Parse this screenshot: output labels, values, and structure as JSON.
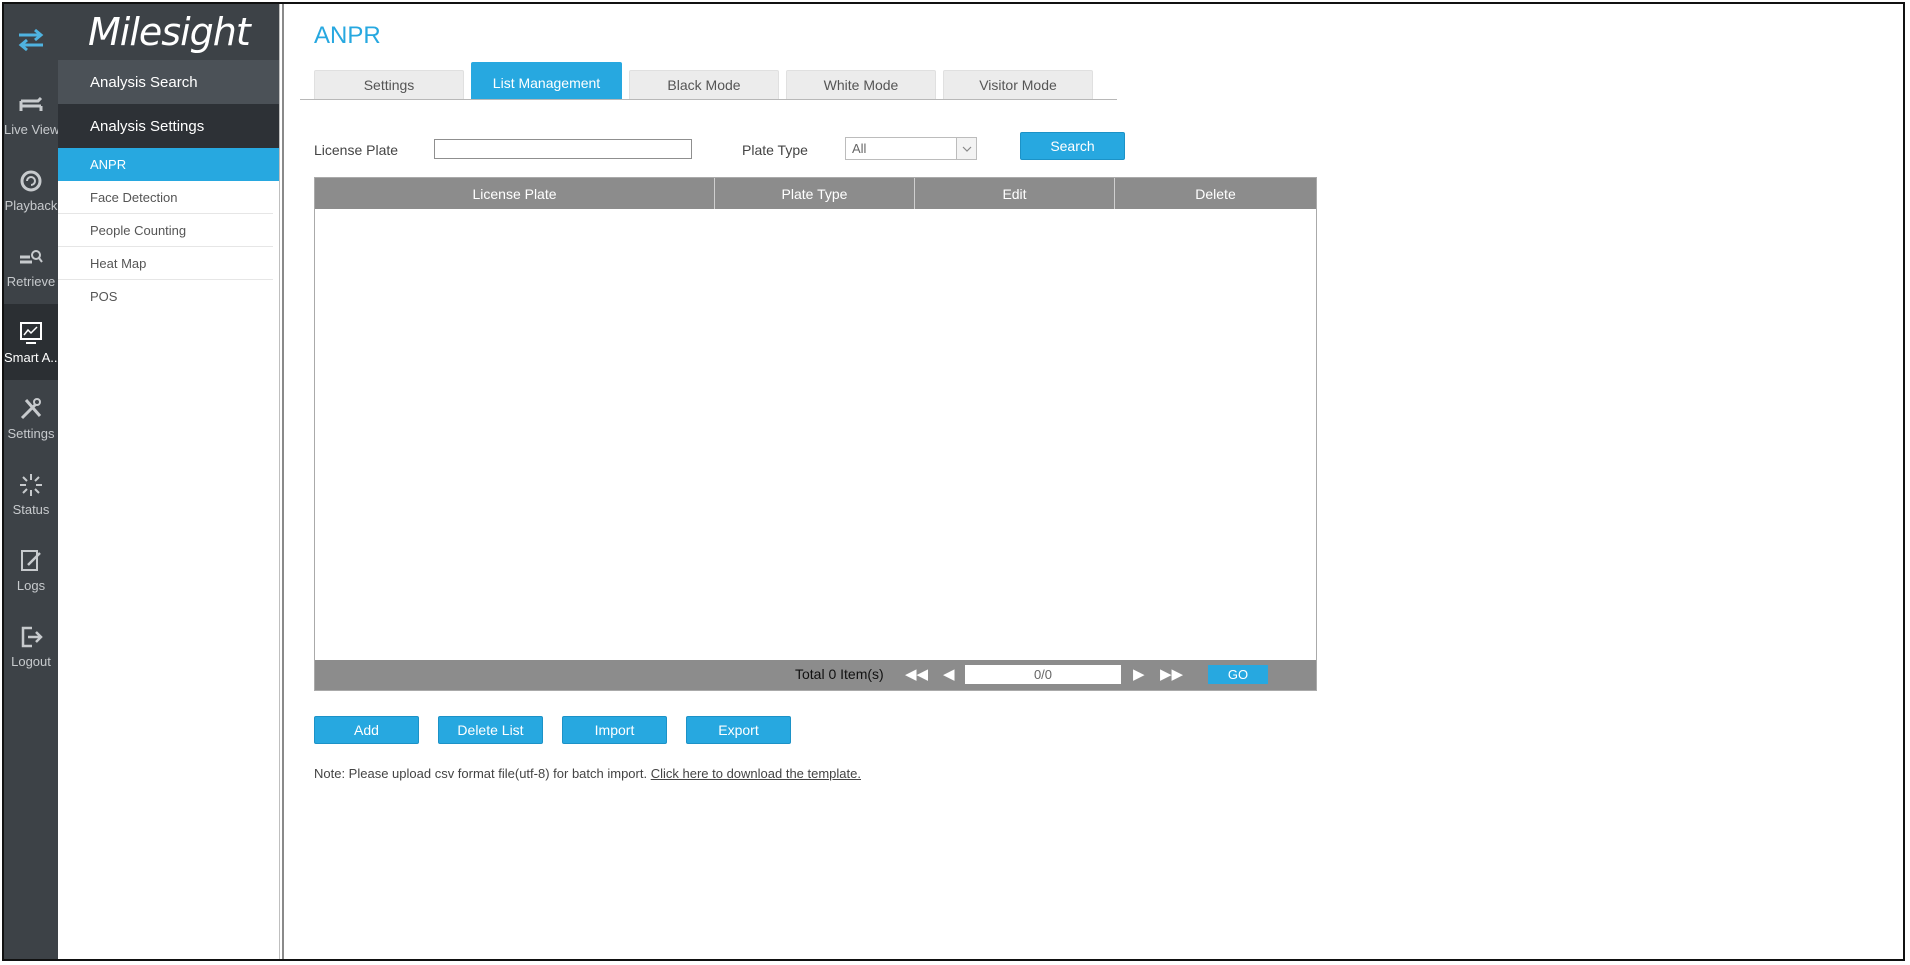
{
  "colors": {
    "accent": "#27a8e0",
    "rail": "#3d4247",
    "table_header": "#8c8c8c"
  },
  "brand": {
    "name": "Milesight"
  },
  "rail": {
    "items": [
      {
        "label": "Live View",
        "icon": "live-view-icon"
      },
      {
        "label": "Playback",
        "icon": "playback-icon"
      },
      {
        "label": "Retrieve",
        "icon": "retrieve-icon"
      },
      {
        "label": "Smart A...",
        "icon": "smart-analytics-icon"
      },
      {
        "label": "Settings",
        "icon": "settings-icon"
      },
      {
        "label": "Status",
        "icon": "status-icon"
      },
      {
        "label": "Logs",
        "icon": "logs-icon"
      },
      {
        "label": "Logout",
        "icon": "logout-icon"
      }
    ]
  },
  "submenu": {
    "group1": "Analysis Search",
    "group2": "Analysis Settings",
    "items": [
      "ANPR",
      "Face Detection",
      "People Counting",
      "Heat Map",
      "POS"
    ]
  },
  "page": {
    "title": "ANPR"
  },
  "tabs": [
    "Settings",
    "List Management",
    "Black Mode",
    "White Mode",
    "Visitor Mode"
  ],
  "filters": {
    "license_plate_label": "License Plate",
    "license_plate_value": "",
    "plate_type_label": "Plate Type",
    "plate_type_value": "All",
    "search_label": "Search"
  },
  "table": {
    "columns": [
      "License Plate",
      "Plate Type",
      "Edit",
      "Delete"
    ],
    "rows": [],
    "total_text": "Total 0 Item(s)",
    "page_value": "0/0",
    "go_label": "GO"
  },
  "actions": {
    "add": "Add",
    "delete_list": "Delete List",
    "import": "Import",
    "export": "Export"
  },
  "note": {
    "text": "Note: Please upload csv format file(utf-8) for batch import. ",
    "link": "Click here to download the template."
  }
}
